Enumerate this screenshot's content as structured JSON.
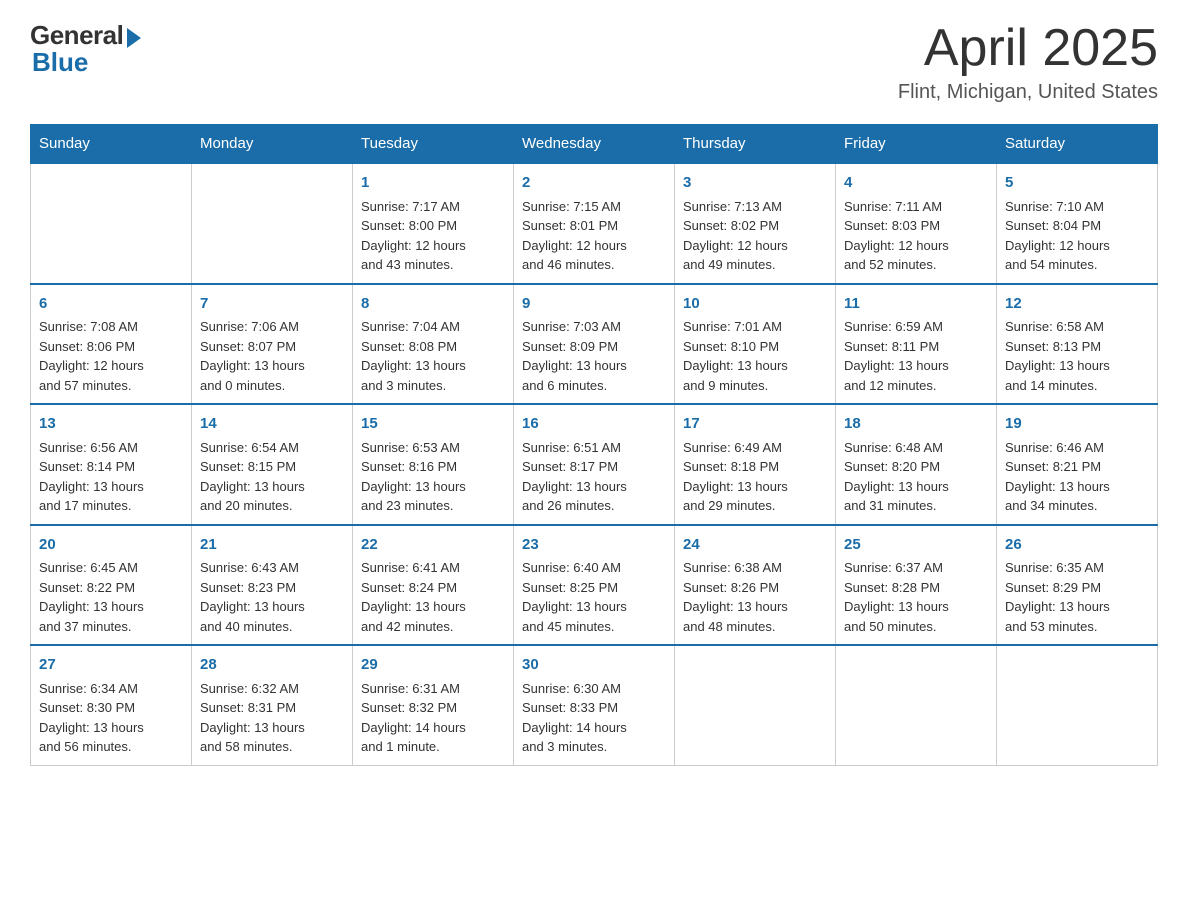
{
  "header": {
    "logo_general": "General",
    "logo_blue": "Blue",
    "month": "April 2025",
    "location": "Flint, Michigan, United States"
  },
  "days_of_week": [
    "Sunday",
    "Monday",
    "Tuesday",
    "Wednesday",
    "Thursday",
    "Friday",
    "Saturday"
  ],
  "weeks": [
    [
      {
        "day": "",
        "info": ""
      },
      {
        "day": "",
        "info": ""
      },
      {
        "day": "1",
        "info": "Sunrise: 7:17 AM\nSunset: 8:00 PM\nDaylight: 12 hours\nand 43 minutes."
      },
      {
        "day": "2",
        "info": "Sunrise: 7:15 AM\nSunset: 8:01 PM\nDaylight: 12 hours\nand 46 minutes."
      },
      {
        "day": "3",
        "info": "Sunrise: 7:13 AM\nSunset: 8:02 PM\nDaylight: 12 hours\nand 49 minutes."
      },
      {
        "day": "4",
        "info": "Sunrise: 7:11 AM\nSunset: 8:03 PM\nDaylight: 12 hours\nand 52 minutes."
      },
      {
        "day": "5",
        "info": "Sunrise: 7:10 AM\nSunset: 8:04 PM\nDaylight: 12 hours\nand 54 minutes."
      }
    ],
    [
      {
        "day": "6",
        "info": "Sunrise: 7:08 AM\nSunset: 8:06 PM\nDaylight: 12 hours\nand 57 minutes."
      },
      {
        "day": "7",
        "info": "Sunrise: 7:06 AM\nSunset: 8:07 PM\nDaylight: 13 hours\nand 0 minutes."
      },
      {
        "day": "8",
        "info": "Sunrise: 7:04 AM\nSunset: 8:08 PM\nDaylight: 13 hours\nand 3 minutes."
      },
      {
        "day": "9",
        "info": "Sunrise: 7:03 AM\nSunset: 8:09 PM\nDaylight: 13 hours\nand 6 minutes."
      },
      {
        "day": "10",
        "info": "Sunrise: 7:01 AM\nSunset: 8:10 PM\nDaylight: 13 hours\nand 9 minutes."
      },
      {
        "day": "11",
        "info": "Sunrise: 6:59 AM\nSunset: 8:11 PM\nDaylight: 13 hours\nand 12 minutes."
      },
      {
        "day": "12",
        "info": "Sunrise: 6:58 AM\nSunset: 8:13 PM\nDaylight: 13 hours\nand 14 minutes."
      }
    ],
    [
      {
        "day": "13",
        "info": "Sunrise: 6:56 AM\nSunset: 8:14 PM\nDaylight: 13 hours\nand 17 minutes."
      },
      {
        "day": "14",
        "info": "Sunrise: 6:54 AM\nSunset: 8:15 PM\nDaylight: 13 hours\nand 20 minutes."
      },
      {
        "day": "15",
        "info": "Sunrise: 6:53 AM\nSunset: 8:16 PM\nDaylight: 13 hours\nand 23 minutes."
      },
      {
        "day": "16",
        "info": "Sunrise: 6:51 AM\nSunset: 8:17 PM\nDaylight: 13 hours\nand 26 minutes."
      },
      {
        "day": "17",
        "info": "Sunrise: 6:49 AM\nSunset: 8:18 PM\nDaylight: 13 hours\nand 29 minutes."
      },
      {
        "day": "18",
        "info": "Sunrise: 6:48 AM\nSunset: 8:20 PM\nDaylight: 13 hours\nand 31 minutes."
      },
      {
        "day": "19",
        "info": "Sunrise: 6:46 AM\nSunset: 8:21 PM\nDaylight: 13 hours\nand 34 minutes."
      }
    ],
    [
      {
        "day": "20",
        "info": "Sunrise: 6:45 AM\nSunset: 8:22 PM\nDaylight: 13 hours\nand 37 minutes."
      },
      {
        "day": "21",
        "info": "Sunrise: 6:43 AM\nSunset: 8:23 PM\nDaylight: 13 hours\nand 40 minutes."
      },
      {
        "day": "22",
        "info": "Sunrise: 6:41 AM\nSunset: 8:24 PM\nDaylight: 13 hours\nand 42 minutes."
      },
      {
        "day": "23",
        "info": "Sunrise: 6:40 AM\nSunset: 8:25 PM\nDaylight: 13 hours\nand 45 minutes."
      },
      {
        "day": "24",
        "info": "Sunrise: 6:38 AM\nSunset: 8:26 PM\nDaylight: 13 hours\nand 48 minutes."
      },
      {
        "day": "25",
        "info": "Sunrise: 6:37 AM\nSunset: 8:28 PM\nDaylight: 13 hours\nand 50 minutes."
      },
      {
        "day": "26",
        "info": "Sunrise: 6:35 AM\nSunset: 8:29 PM\nDaylight: 13 hours\nand 53 minutes."
      }
    ],
    [
      {
        "day": "27",
        "info": "Sunrise: 6:34 AM\nSunset: 8:30 PM\nDaylight: 13 hours\nand 56 minutes."
      },
      {
        "day": "28",
        "info": "Sunrise: 6:32 AM\nSunset: 8:31 PM\nDaylight: 13 hours\nand 58 minutes."
      },
      {
        "day": "29",
        "info": "Sunrise: 6:31 AM\nSunset: 8:32 PM\nDaylight: 14 hours\nand 1 minute."
      },
      {
        "day": "30",
        "info": "Sunrise: 6:30 AM\nSunset: 8:33 PM\nDaylight: 14 hours\nand 3 minutes."
      },
      {
        "day": "",
        "info": ""
      },
      {
        "day": "",
        "info": ""
      },
      {
        "day": "",
        "info": ""
      }
    ]
  ]
}
